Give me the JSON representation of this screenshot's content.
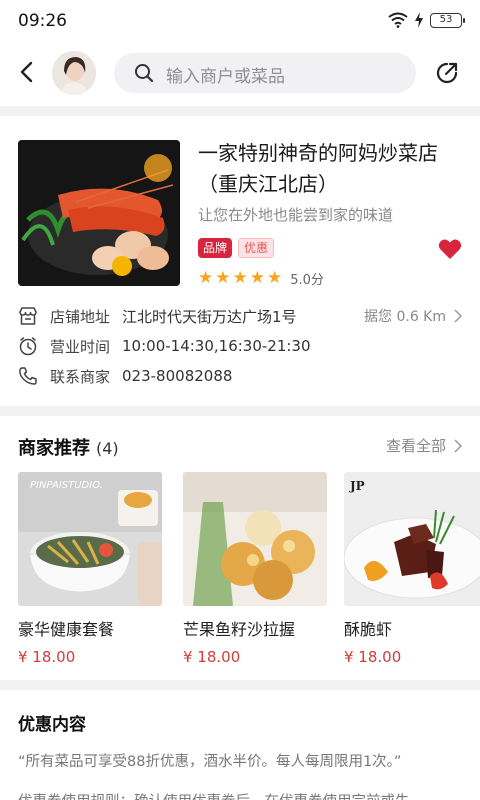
{
  "status_bar": {
    "time": "09:26",
    "battery": "53"
  },
  "nav": {
    "search_placeholder": "输入商户或菜品"
  },
  "shop": {
    "name": "一家特别神奇的阿妈炒菜店（重庆江北店）",
    "slogan": "让您在外地也能尝到家的味道",
    "tags": [
      "品牌",
      "优惠"
    ],
    "rating_stars": 5,
    "rating_text": "5.0分",
    "favorited": true,
    "address_label": "店铺地址",
    "address": "江北时代天街万达广场1号",
    "distance": "据您 0.6 Km",
    "hours_label": "营业时间",
    "hours": "10:00-14:30,16:30-21:30",
    "contact_label": "联系商家",
    "phone": "023-80082088"
  },
  "recommend": {
    "title": "商家推荐",
    "count": "(4)",
    "view_all": "查看全部",
    "dishes": [
      {
        "name": "豪华健康套餐",
        "price": "¥ 18.00",
        "image_caption": "PINPAISTUDIO."
      },
      {
        "name": "芒果鱼籽沙拉握",
        "price": "¥ 18.00"
      },
      {
        "name": "酥脆虾",
        "price": "¥ 18.00",
        "image_caption": "JP"
      }
    ]
  },
  "promo": {
    "title": "优惠内容",
    "text": "“所有菜品可享受88折优惠，酒水半价。每人每周限用1次。”",
    "text2": "优惠券使用规则：确认使用优惠券后，在优惠券使用完前或失"
  },
  "colors": {
    "accent": "#d6253c",
    "price": "#d23c3c",
    "star": "#f5a623",
    "divider": "#f2f2f4"
  }
}
